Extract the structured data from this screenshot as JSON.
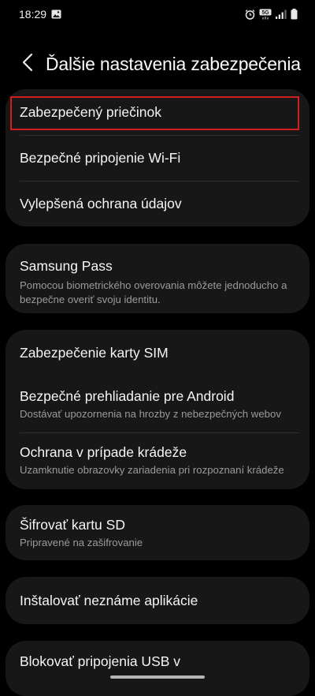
{
  "status_bar": {
    "time": "18:29",
    "icons_left": [
      "gallery-icon"
    ],
    "icons_right": [
      "alarm-icon",
      "5g-icon",
      "signal-icon",
      "battery-icon"
    ]
  },
  "header": {
    "back_icon": "chevron-left-icon",
    "title": "Ďalšie nastavenia zabezpečenia"
  },
  "groups": [
    {
      "items": [
        {
          "title": "Zabezpečený priečinok",
          "highlighted": true
        },
        {
          "title": "Bezpečné pripojenie Wi-Fi"
        },
        {
          "title": "Vylepšená ochrana údajov"
        }
      ]
    },
    {
      "items": [
        {
          "title": "Samsung Pass",
          "subtitle_line1": "Pomocou biometrického overovania môžete jednoducho a",
          "subtitle_line2": "bezpečne overiť svoju identitu."
        }
      ]
    },
    {
      "items": [
        {
          "title": "Zabezpečenie karty SIM"
        },
        {
          "title": "Bezpečné prehliadanie pre Android",
          "subtitle": "Dostávať upozornenia na hrozby z nebezpečných webov"
        },
        {
          "title": "Ochrana v prípade krádeže",
          "subtitle": "Uzamknutie obrazovky zariadenia pri rozpoznaní krádeže"
        }
      ]
    },
    {
      "items": [
        {
          "title": "Šifrovať kartu SD",
          "subtitle": "Pripravené na zašifrovanie"
        }
      ]
    },
    {
      "items": [
        {
          "title": "Inštalovať neznáme aplikácie"
        }
      ]
    },
    {
      "items": [
        {
          "title": "Blokovať pripojenia USB v"
        }
      ]
    }
  ],
  "colors": {
    "background": "#000000",
    "card": "#171717",
    "highlight_border": "#d01f1f",
    "subtitle": "#9a9a9a"
  }
}
